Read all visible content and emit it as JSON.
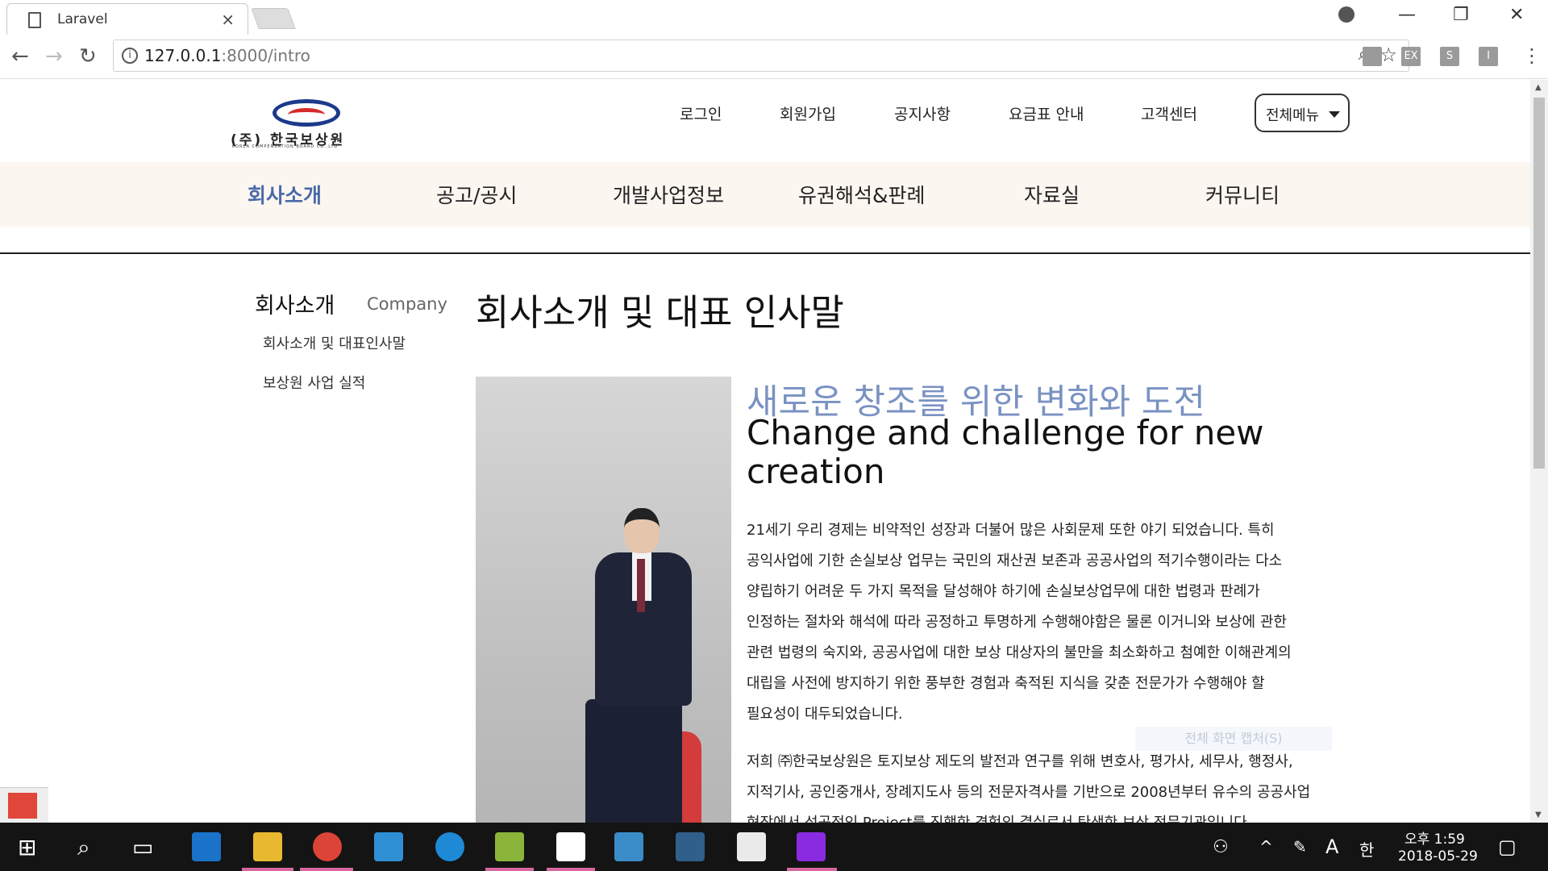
{
  "browser": {
    "tab_title": "Laravel",
    "tab_close": "×",
    "url_host": "127.0.0.1",
    "url_rest": ":8000/intro",
    "ext_labels": [
      "",
      "EX",
      "S",
      "I"
    ]
  },
  "header": {
    "logo_name": "(주) 한국보상원",
    "logo_sub": "KOREA COMPENSATION BOARD CO.,LTD",
    "util_nav": [
      "로그인",
      "회원가입",
      "공지사항",
      "요금표 안내",
      "고객센터"
    ],
    "all_menu": "전체메뉴"
  },
  "gnb": [
    "회사소개",
    "공고/공시",
    "개발사업정보",
    "유권해석&판례",
    "자료실",
    "커뮤니티"
  ],
  "lnb": {
    "title": "회사소개",
    "title_en": "Company",
    "links": [
      "회사소개 및 대표인사말",
      "보상원 사업 실적"
    ]
  },
  "content": {
    "page_title": "회사소개 및 대표 인사말",
    "heading_ko": "새로운 창조를 위한 변화와 도전",
    "heading_en": "Change and challenge for new creation",
    "paragraph1": "21세기 우리 경제는 비약적인 성장과 더불어 많은 사회문제 또한 야기 되었습니다. 특히 공익사업에 기한 손실보상 업무는 국민의 재산권 보존과 공공사업의 적기수행이라는 다소 양립하기 어려운 두 가지 목적을 달성해야 하기에 손실보상업무에 대한 법령과 판례가 인정하는 절차와 해석에 따라 공정하고 투명하게 수행해야함은 물론 이거니와 보상에 관한 관련 법령의 숙지와, 공공사업에 대한 보상 대상자의 불만을 최소화하고 첨예한 이해관계의 대립을 사전에 방지하기 위한 풍부한 경험과 축적된 지식을 갖춘 전문가가 수행해야 할 필요성이 대두되었습니다.",
    "paragraph2": "저희 ㈜한국보상원은 토지보상 제도의 발전과 연구를 위해 변호사, 평가사, 세무사, 행정사, 지적기사, 공인중개사, 장례지도사 등의 전문자격사를 기반으로 2008년부터 유수의 공공사업 현장에서 성공적인 Project를 진행한 경험의 결실로서 탄생한 보상 전문기관입니다.",
    "overlay_caption": "전체 화면 캡처(S)"
  },
  "taskbar": {
    "time": "오후 1:59",
    "date": "2018-05-29",
    "ime_a": "A",
    "ime_han": "한"
  }
}
